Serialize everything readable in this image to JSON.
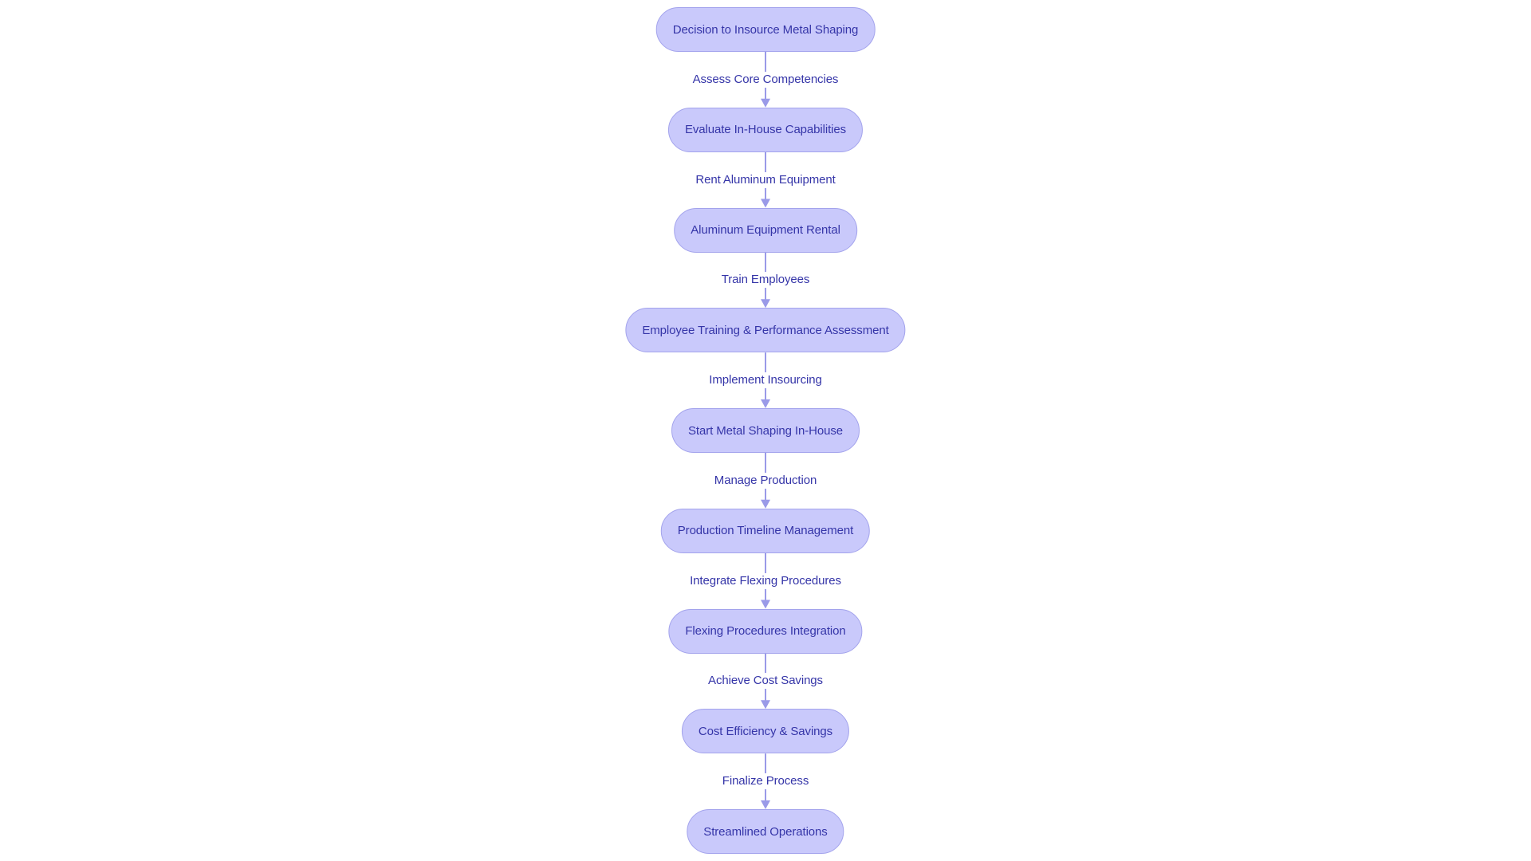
{
  "diagram": {
    "type": "flowchart",
    "direction": "top-to-bottom",
    "colors": {
      "node_fill": "#c9c9fb",
      "node_border": "#a3a3ec",
      "text": "#3535a8",
      "edge": "#9a9ae8",
      "background": "#ffffff"
    },
    "nodes": [
      {
        "id": "n1",
        "label": "Decision to Insource Metal Shaping"
      },
      {
        "id": "n2",
        "label": "Evaluate In-House Capabilities"
      },
      {
        "id": "n3",
        "label": "Aluminum Equipment Rental"
      },
      {
        "id": "n4",
        "label": "Employee Training & Performance Assessment"
      },
      {
        "id": "n5",
        "label": "Start Metal Shaping In-House"
      },
      {
        "id": "n6",
        "label": "Production Timeline Management"
      },
      {
        "id": "n7",
        "label": "Flexing Procedures Integration"
      },
      {
        "id": "n8",
        "label": "Cost Efficiency & Savings"
      },
      {
        "id": "n9",
        "label": "Streamlined Operations"
      }
    ],
    "edges": [
      {
        "from": "n1",
        "to": "n2",
        "label": "Assess Core Competencies"
      },
      {
        "from": "n2",
        "to": "n3",
        "label": "Rent Aluminum Equipment"
      },
      {
        "from": "n3",
        "to": "n4",
        "label": "Train Employees"
      },
      {
        "from": "n4",
        "to": "n5",
        "label": "Implement Insourcing"
      },
      {
        "from": "n5",
        "to": "n6",
        "label": "Manage Production"
      },
      {
        "from": "n6",
        "to": "n7",
        "label": "Integrate Flexing Procedures"
      },
      {
        "from": "n7",
        "to": "n8",
        "label": "Achieve Cost Savings"
      },
      {
        "from": "n8",
        "to": "n9",
        "label": "Finalize Process"
      }
    ]
  }
}
